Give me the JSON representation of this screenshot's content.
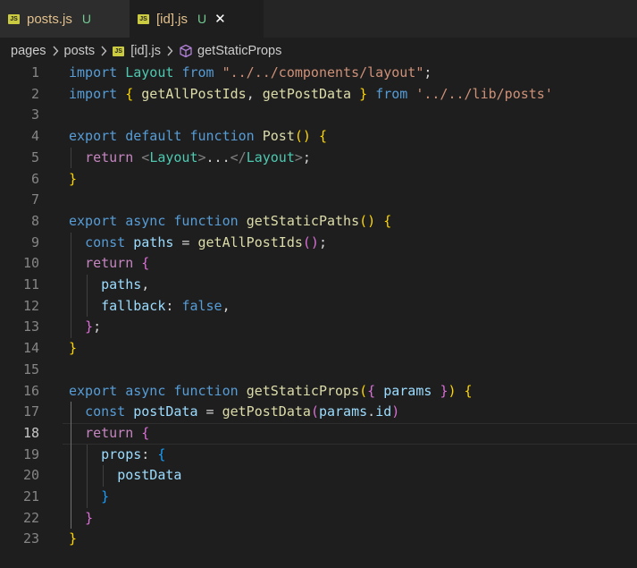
{
  "tabs": [
    {
      "icon": "js-file-icon",
      "icon_text": "JS",
      "name": "posts.js",
      "badge": "U",
      "active": false
    },
    {
      "icon": "js-file-icon",
      "icon_text": "JS",
      "name": "[id].js",
      "badge": "U",
      "active": true,
      "close": "✕"
    }
  ],
  "breadcrumb": {
    "items": [
      "pages",
      "posts",
      "[id].js",
      "getStaticProps"
    ],
    "separator": "›",
    "file_icon_text": "JS"
  },
  "editor": {
    "current_line": 18,
    "lines": [
      [
        [
          "kw",
          "import"
        ],
        [
          "p",
          " "
        ],
        [
          "cls",
          "Layout"
        ],
        [
          "p",
          " "
        ],
        [
          "kw",
          "from"
        ],
        [
          "p",
          " "
        ],
        [
          "str",
          "\"../../components/layout\""
        ],
        [
          "p",
          ";"
        ]
      ],
      [
        [
          "kw",
          "import"
        ],
        [
          "p",
          " "
        ],
        [
          "b1",
          "{"
        ],
        [
          "p",
          " "
        ],
        [
          "fn",
          "getAllPostIds"
        ],
        [
          "p",
          ", "
        ],
        [
          "fn",
          "getPostData"
        ],
        [
          "p",
          " "
        ],
        [
          "b1",
          "}"
        ],
        [
          "p",
          " "
        ],
        [
          "kw",
          "from"
        ],
        [
          "p",
          " "
        ],
        [
          "str",
          "'../../lib/posts'"
        ]
      ],
      [],
      [
        [
          "kw",
          "export"
        ],
        [
          "p",
          " "
        ],
        [
          "kw",
          "default"
        ],
        [
          "p",
          " "
        ],
        [
          "kw",
          "function"
        ],
        [
          "p",
          " "
        ],
        [
          "fn",
          "Post"
        ],
        [
          "b1",
          "()"
        ],
        [
          "p",
          " "
        ],
        [
          "b1",
          "{"
        ]
      ],
      [
        [
          "p",
          "  "
        ],
        [
          "ctl",
          "return"
        ],
        [
          "p",
          " "
        ],
        [
          "tag",
          "<"
        ],
        [
          "cls",
          "Layout"
        ],
        [
          "tag",
          ">"
        ],
        [
          "p",
          "..."
        ],
        [
          "tag",
          "</"
        ],
        [
          "cls",
          "Layout"
        ],
        [
          "tag",
          ">"
        ],
        [
          "p",
          ";"
        ]
      ],
      [
        [
          "b1",
          "}"
        ]
      ],
      [],
      [
        [
          "kw",
          "export"
        ],
        [
          "p",
          " "
        ],
        [
          "kw",
          "async"
        ],
        [
          "p",
          " "
        ],
        [
          "kw",
          "function"
        ],
        [
          "p",
          " "
        ],
        [
          "fn",
          "getStaticPaths"
        ],
        [
          "b1",
          "()"
        ],
        [
          "p",
          " "
        ],
        [
          "b1",
          "{"
        ]
      ],
      [
        [
          "p",
          "  "
        ],
        [
          "kw",
          "const"
        ],
        [
          "p",
          " "
        ],
        [
          "var",
          "paths"
        ],
        [
          "p",
          " = "
        ],
        [
          "fn",
          "getAllPostIds"
        ],
        [
          "b2",
          "()"
        ],
        [
          "p",
          ";"
        ]
      ],
      [
        [
          "p",
          "  "
        ],
        [
          "ctl",
          "return"
        ],
        [
          "p",
          " "
        ],
        [
          "b2",
          "{"
        ]
      ],
      [
        [
          "p",
          "    "
        ],
        [
          "var",
          "paths"
        ],
        [
          "p",
          ","
        ]
      ],
      [
        [
          "p",
          "    "
        ],
        [
          "var",
          "fallback"
        ],
        [
          "p",
          ": "
        ],
        [
          "kw",
          "false"
        ],
        [
          "p",
          ","
        ]
      ],
      [
        [
          "p",
          "  "
        ],
        [
          "b2",
          "}"
        ],
        [
          "p",
          ";"
        ]
      ],
      [
        [
          "b1",
          "}"
        ]
      ],
      [],
      [
        [
          "kw",
          "export"
        ],
        [
          "p",
          " "
        ],
        [
          "kw",
          "async"
        ],
        [
          "p",
          " "
        ],
        [
          "kw",
          "function"
        ],
        [
          "p",
          " "
        ],
        [
          "fn",
          "getStaticProps"
        ],
        [
          "b1",
          "("
        ],
        [
          "b2",
          "{"
        ],
        [
          "p",
          " "
        ],
        [
          "var",
          "params"
        ],
        [
          "p",
          " "
        ],
        [
          "b2",
          "}"
        ],
        [
          "b1",
          ")"
        ],
        [
          "p",
          " "
        ],
        [
          "b1",
          "{"
        ]
      ],
      [
        [
          "p",
          "  "
        ],
        [
          "kw",
          "const"
        ],
        [
          "p",
          " "
        ],
        [
          "var",
          "postData"
        ],
        [
          "p",
          " = "
        ],
        [
          "fn",
          "getPostData"
        ],
        [
          "b2",
          "("
        ],
        [
          "var",
          "params"
        ],
        [
          "p",
          "."
        ],
        [
          "var",
          "id"
        ],
        [
          "b2",
          ")"
        ]
      ],
      [
        [
          "p",
          "  "
        ],
        [
          "ctl",
          "return"
        ],
        [
          "p",
          " "
        ],
        [
          "b2",
          "{"
        ]
      ],
      [
        [
          "p",
          "    "
        ],
        [
          "var",
          "props"
        ],
        [
          "p",
          ": "
        ],
        [
          "b3",
          "{"
        ]
      ],
      [
        [
          "p",
          "      "
        ],
        [
          "var",
          "postData"
        ]
      ],
      [
        [
          "p",
          "    "
        ],
        [
          "b3",
          "}"
        ]
      ],
      [
        [
          "p",
          "  "
        ],
        [
          "b2",
          "}"
        ]
      ],
      [
        [
          "b1",
          "}"
        ]
      ]
    ]
  }
}
